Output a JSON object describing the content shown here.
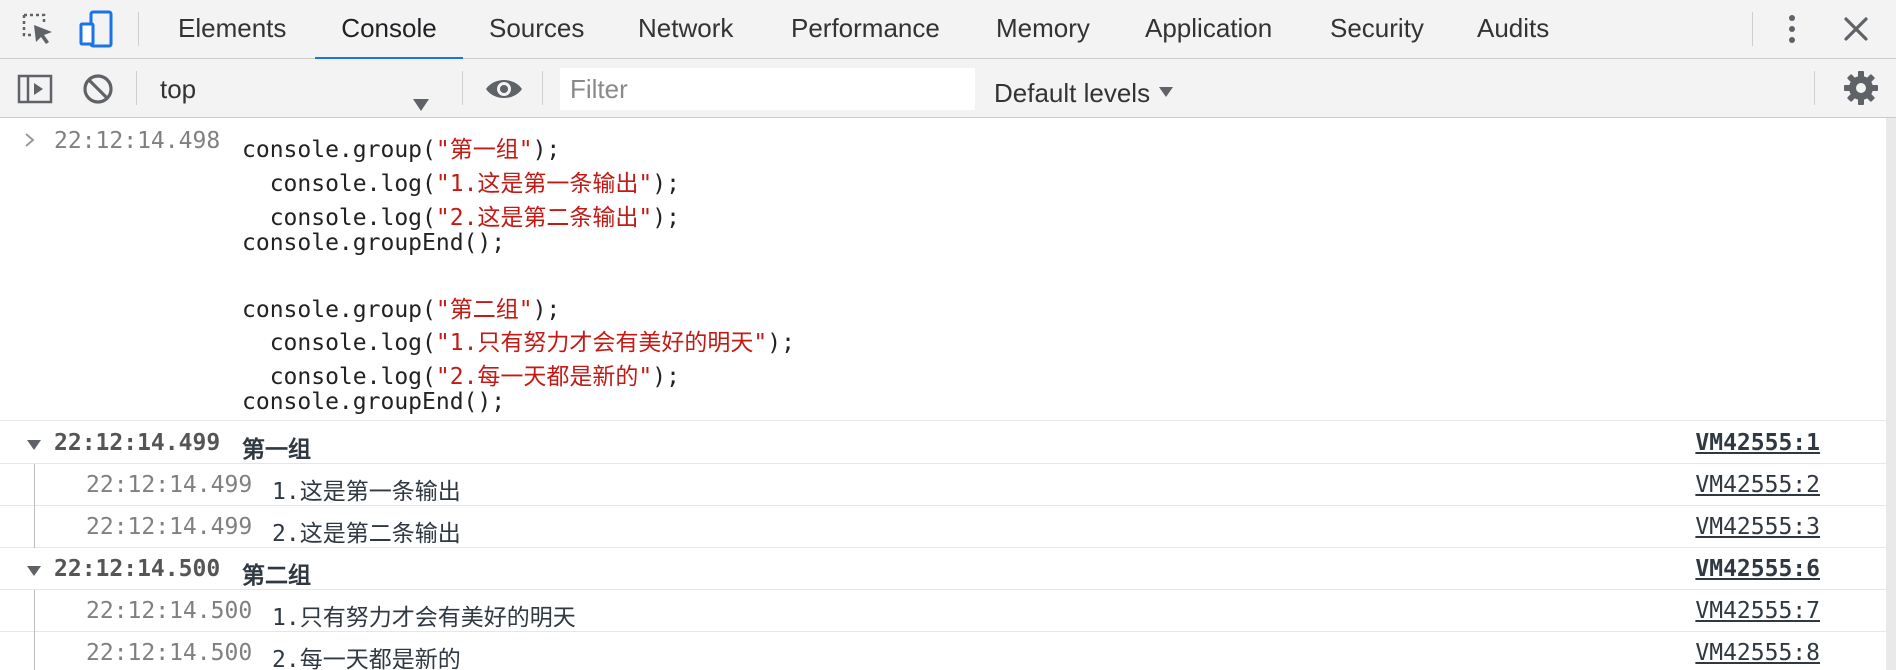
{
  "tabbar": {
    "tabs": [
      {
        "label": "Elements",
        "active": false
      },
      {
        "label": "Console",
        "active": true
      },
      {
        "label": "Sources",
        "active": false
      },
      {
        "label": "Network",
        "active": false
      },
      {
        "label": "Performance",
        "active": false
      },
      {
        "label": "Memory",
        "active": false
      },
      {
        "label": "Application",
        "active": false
      },
      {
        "label": "Security",
        "active": false
      },
      {
        "label": "Audits",
        "active": false
      }
    ],
    "icons": [
      "inspect-element-icon",
      "device-toolbar-icon",
      "more-options-icon",
      "close-icon"
    ]
  },
  "toolbar": {
    "context": "top",
    "filter_placeholder": "Filter",
    "filter_value": "",
    "levels_label": "Default levels",
    "icons": [
      "sidebar-toggle-icon",
      "clear-console-icon",
      "live-expression-eye-icon",
      "settings-gear-icon"
    ]
  },
  "console": {
    "input": {
      "timestamp": "22:12:14.498",
      "lines": [
        {
          "pre": "console.group(",
          "str": "\"第一组\"",
          "post": ");"
        },
        {
          "pre": "  console.log(",
          "str": "\"1.这是第一条输出\"",
          "post": ");"
        },
        {
          "pre": "  console.log(",
          "str": "\"2.这是第二条输出\"",
          "post": ");"
        },
        {
          "pre": "console.groupEnd();",
          "str": "",
          "post": ""
        },
        {
          "pre": "",
          "str": "",
          "post": ""
        },
        {
          "pre": "console.group(",
          "str": "\"第二组\"",
          "post": ");"
        },
        {
          "pre": "  console.log(",
          "str": "\"1.只有努力才会有美好的明天\"",
          "post": ");"
        },
        {
          "pre": "  console.log(",
          "str": "\"2.每一天都是新的\"",
          "post": ");"
        },
        {
          "pre": "console.groupEnd();",
          "str": "",
          "post": ""
        }
      ]
    },
    "groups": [
      {
        "timestamp": "22:12:14.499",
        "title": "第一组",
        "source": "VM42555:1",
        "messages": [
          {
            "timestamp": "22:12:14.499",
            "text": "1.这是第一条输出",
            "source": "VM42555:2"
          },
          {
            "timestamp": "22:12:14.499",
            "text": "2.这是第二条输出",
            "source": "VM42555:3"
          }
        ]
      },
      {
        "timestamp": "22:12:14.500",
        "title": "第二组",
        "source": "VM42555:6",
        "messages": [
          {
            "timestamp": "22:12:14.500",
            "text": "1.只有努力才会有美好的明天",
            "source": "VM42555:7"
          },
          {
            "timestamp": "22:12:14.500",
            "text": "2.每一天都是新的",
            "source": "VM42555:8"
          }
        ]
      }
    ]
  },
  "colors": {
    "accent": "#1a73e8",
    "string": "#c41a16",
    "timestamp": "#808080",
    "toolbar_bg": "#f3f3f3"
  }
}
